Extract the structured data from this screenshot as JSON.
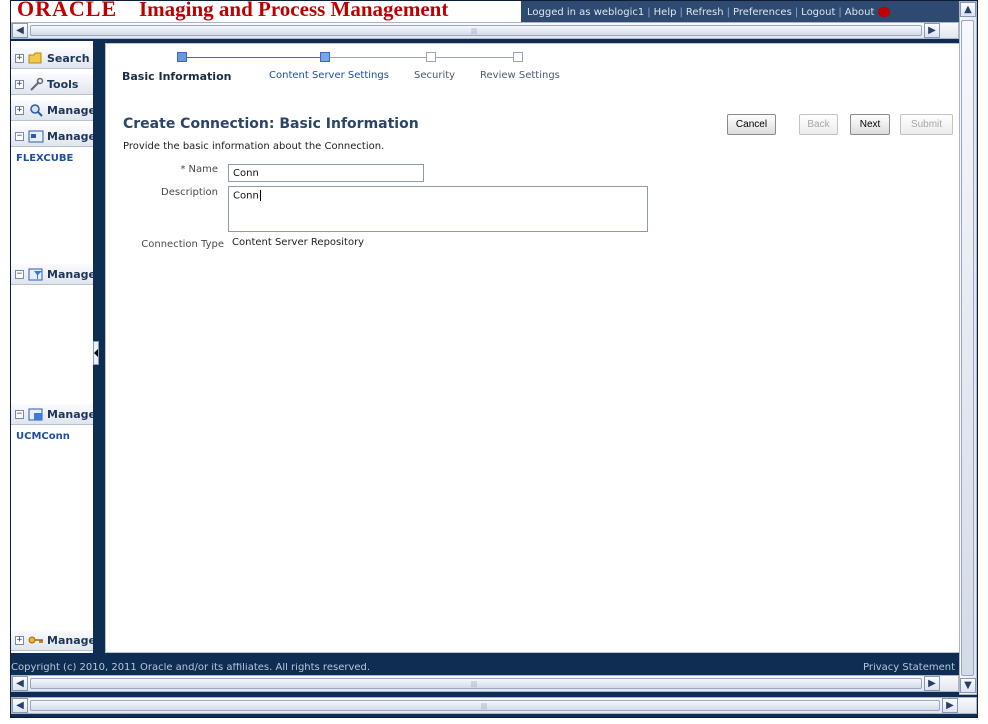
{
  "header": {
    "logo": "ORACLE",
    "title": "Imaging and Process Management",
    "links": [
      "Logged in as weblogic1",
      "Help",
      "Refresh",
      "Preferences",
      "Logout",
      "About"
    ]
  },
  "left_nav": {
    "sections": [
      {
        "label": "Search",
        "icon": "folder-search-icon",
        "expanded": false
      },
      {
        "label": "Tools",
        "icon": "tools-icon",
        "expanded": false
      },
      {
        "label": "Manage",
        "icon": "magnifier-icon",
        "expanded": false
      },
      {
        "label": "Manage",
        "icon": "application-icon",
        "expanded": true,
        "items": [
          "FLEXCUBE"
        ]
      },
      {
        "label": "Manage",
        "icon": "filter-icon",
        "expanded": true,
        "items": []
      },
      {
        "label": "Manage",
        "icon": "connection-icon",
        "expanded": true,
        "items": [
          "UCMConn"
        ]
      },
      {
        "label": "Manage",
        "icon": "key-icon",
        "expanded": false
      }
    ]
  },
  "train": {
    "steps": [
      {
        "label": "Basic Information",
        "state": "current"
      },
      {
        "label": "Content Server Settings",
        "state": "link"
      },
      {
        "label": "Security",
        "state": "unvisited"
      },
      {
        "label": "Review Settings",
        "state": "unvisited"
      }
    ]
  },
  "page": {
    "title": "Create Connection: Basic Information",
    "instructions": "Provide the basic information about the Connection."
  },
  "buttons": {
    "cancel": "Cancel",
    "back": "Back",
    "next": "Next",
    "submit": "Submit"
  },
  "form": {
    "name": {
      "label": "Name",
      "required_marker": "*",
      "value": "Conn"
    },
    "description": {
      "label": "Description",
      "value": "Conn"
    },
    "connection_type": {
      "label": "Connection Type",
      "value": "Content Server Repository"
    }
  },
  "footer": {
    "copyright": "Copyright (c) 2010, 2011 Oracle and/or its affiliates. All rights reserved.",
    "privacy": "Privacy Statement"
  },
  "colors": {
    "brand_red": "#c00000",
    "frame_navy": "#0f2c52",
    "link_blue": "#1f4ea1"
  }
}
